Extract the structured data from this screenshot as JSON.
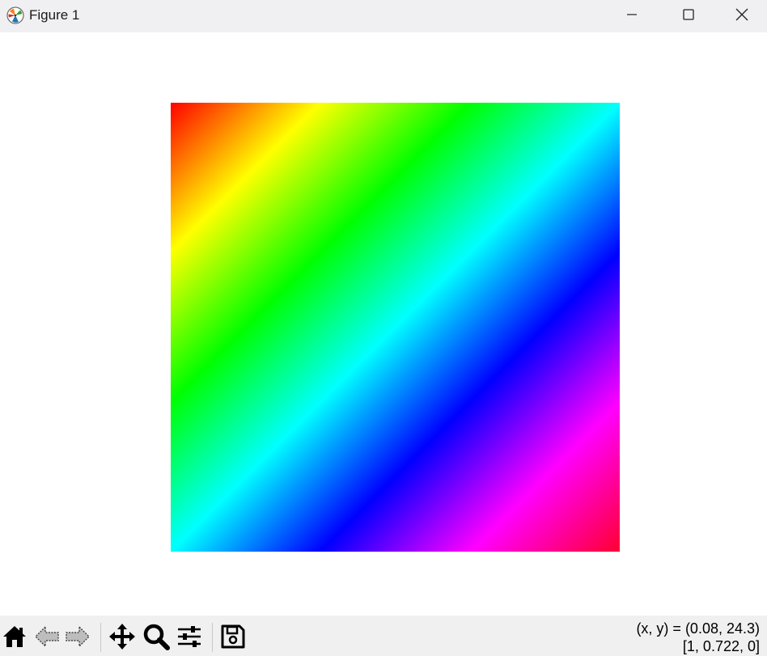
{
  "window": {
    "title": "Figure 1"
  },
  "title_buttons": {
    "minimize_icon": "minimize-icon",
    "maximize_icon": "maximize-icon",
    "close_icon": "close-icon"
  },
  "figure": {
    "image": {
      "type": "hsv-diagonal-gradient",
      "corner_top_left": "#ff0000",
      "corner_bottom_right": "#ff0033",
      "hue_stops": [
        "#ff0000",
        "#ffff00",
        "#00ff00",
        "#00ffff",
        "#0000ff",
        "#ff00ff",
        "#ff0000"
      ]
    }
  },
  "toolbar": {
    "tools": [
      {
        "name": "home",
        "icon": "home-icon"
      },
      {
        "name": "back",
        "icon": "back-arrow-icon"
      },
      {
        "name": "forward",
        "icon": "forward-arrow-icon"
      },
      {
        "name": "pan",
        "icon": "move-icon"
      },
      {
        "name": "zoom",
        "icon": "zoom-icon"
      },
      {
        "name": "configure",
        "icon": "sliders-icon"
      },
      {
        "name": "save",
        "icon": "save-icon"
      }
    ],
    "coords_line1": "(x, y) = (0.08, 24.3)",
    "coords_line2": "[1, 0.722, 0]"
  }
}
